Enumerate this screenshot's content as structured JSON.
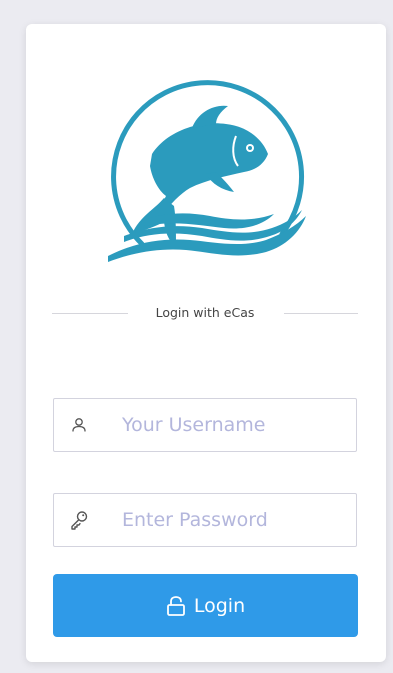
{
  "brand": {
    "logo_icon": "fish-wave-logo-icon",
    "color": "#2b9bbd"
  },
  "divider": {
    "label": "Login with eCas"
  },
  "username": {
    "placeholder": "Your Username",
    "value": "",
    "icon": "user-icon"
  },
  "password": {
    "placeholder": "Enter Password",
    "value": "",
    "icon": "key-icon"
  },
  "login_button": {
    "label": "Login",
    "icon": "unlock-icon",
    "color": "#2f9ae8"
  }
}
